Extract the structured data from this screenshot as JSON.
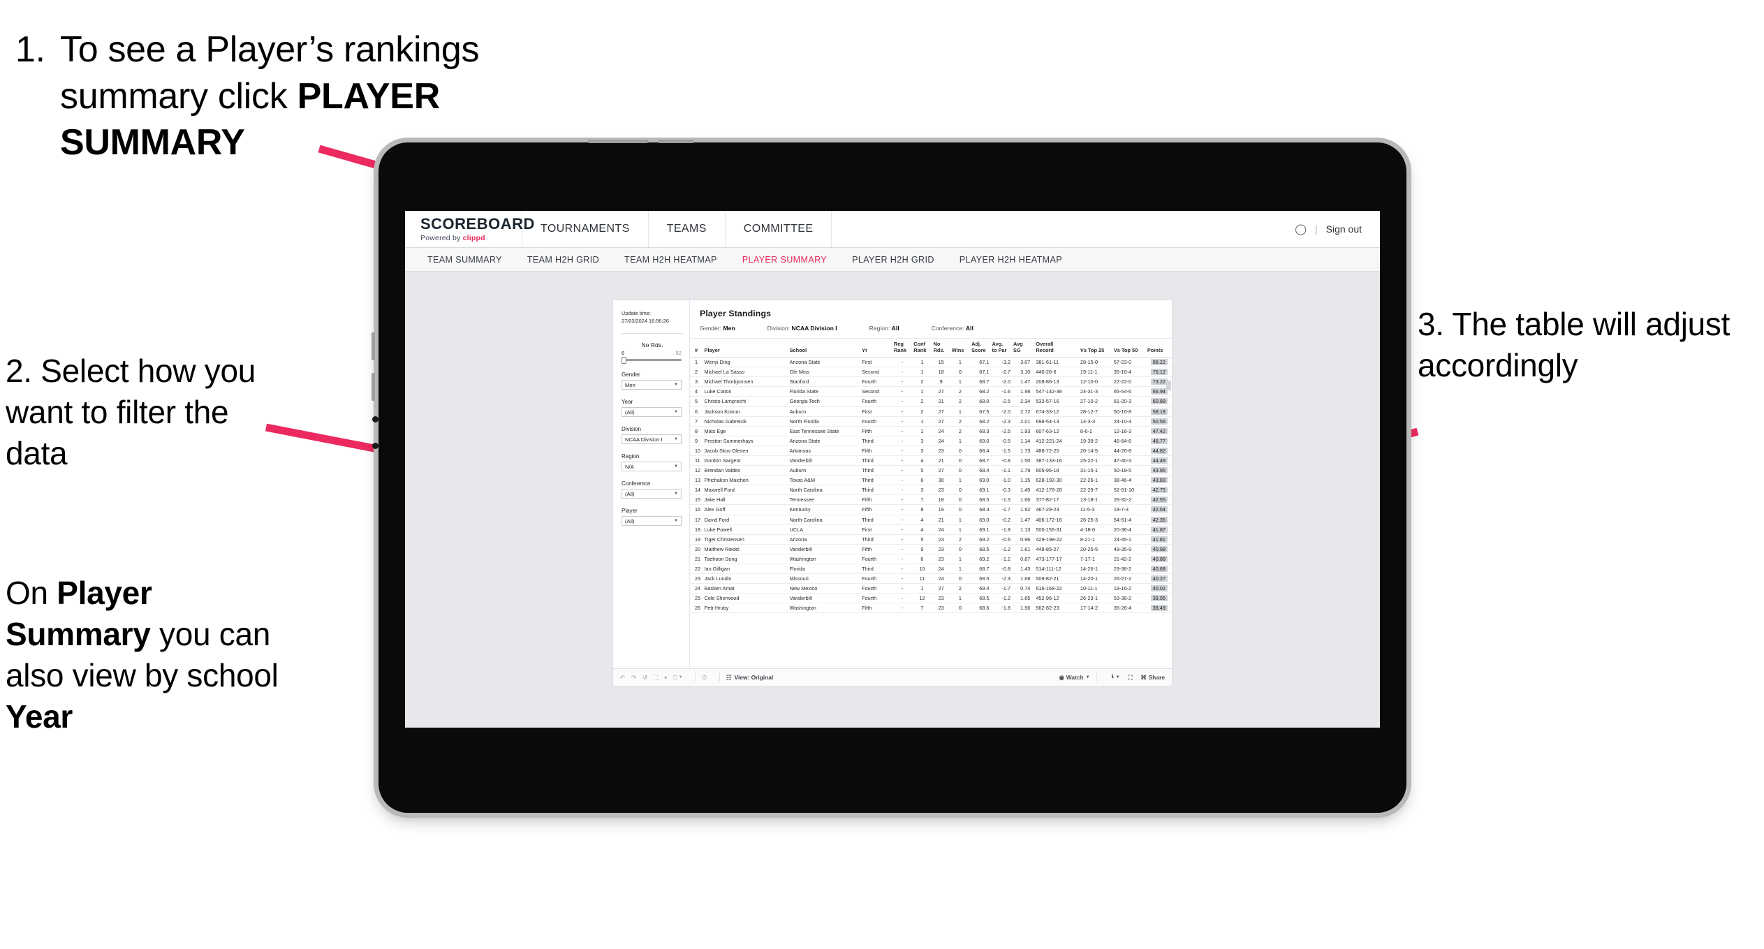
{
  "callouts": {
    "one": {
      "number": "1.",
      "line1_pre": "To see a Player’s rankings",
      "line2_pre": "summary click ",
      "line2_bold": "PLAYER",
      "line3_bold": "SUMMARY"
    },
    "two": {
      "text": "2. Select how you want to filter the data"
    },
    "two_b": {
      "pre": "On ",
      "bold1": "Player Summary",
      "mid": " you can also view by school ",
      "bold2": "Year"
    },
    "three": {
      "text": "3. The table will adjust accordingly"
    }
  },
  "accent_color": "#e8285a",
  "app": {
    "brand": {
      "name": "SCOREBOARD",
      "powered_by_prefix": "Powered by ",
      "powered_by_brand": "clippd"
    },
    "top_nav": [
      {
        "label": "TOURNAMENTS"
      },
      {
        "label": "TEAMS"
      },
      {
        "label": "COMMITTEE"
      }
    ],
    "top_right": {
      "user_icon": "user-icon",
      "separator": "|",
      "sign_out": "Sign out"
    },
    "sub_nav": [
      {
        "label": "TEAM SUMMARY",
        "active": false
      },
      {
        "label": "TEAM H2H GRID",
        "active": false
      },
      {
        "label": "TEAM H2H HEATMAP",
        "active": false
      },
      {
        "label": "PLAYER SUMMARY",
        "active": true
      },
      {
        "label": "PLAYER H2H GRID",
        "active": false
      },
      {
        "label": "PLAYER H2H HEATMAP",
        "active": false
      }
    ]
  },
  "filters": {
    "update_time_label": "Update time:",
    "update_time_value": "27/03/2024 16:56:26",
    "slider": {
      "label": "No Rds.",
      "min_value": "6",
      "max_value": "52"
    },
    "groups": [
      {
        "label": "Gender",
        "value": "Men"
      },
      {
        "label": "Year",
        "value": "(All)"
      },
      {
        "label": "Division",
        "value": "NCAA Division I"
      },
      {
        "label": "Region",
        "value": "N/A"
      },
      {
        "label": "Conference",
        "value": "(All)"
      },
      {
        "label": "Player",
        "value": "(All)"
      }
    ]
  },
  "viz": {
    "title": "Player Standings",
    "filter_line": [
      {
        "label": "Gender:",
        "value": "Men"
      },
      {
        "label": "Division:",
        "value": "NCAA Division I"
      },
      {
        "label": "Region:",
        "value": "All"
      },
      {
        "label": "Conference:",
        "value": "All"
      }
    ],
    "toolbar": {
      "view_label": "View: Original",
      "watch_label": "Watch",
      "share_label": "Share"
    }
  },
  "chart_data": {
    "type": "table",
    "title": "Player Standings",
    "columns": [
      "#",
      "Player",
      "School",
      "Yr",
      "Reg Rank",
      "Conf Rank",
      "No Rds.",
      "Wins",
      "Adj. Score",
      "Avg. to Par",
      "Avg SG",
      "Overall Record",
      "Vs Top 25",
      "Vs Top 50",
      "Points"
    ],
    "column_headers_two_line": [
      [
        "#",
        ""
      ],
      [
        "Player",
        ""
      ],
      [
        "School",
        ""
      ],
      [
        "Yr",
        ""
      ],
      [
        "Reg",
        "Rank"
      ],
      [
        "Conf",
        "Rank"
      ],
      [
        "No",
        "Rds."
      ],
      [
        "",
        "Wins"
      ],
      [
        "Adj.",
        "Score"
      ],
      [
        "Avg.",
        "to Par"
      ],
      [
        "Avg",
        "SG"
      ],
      [
        "Overall",
        "Record"
      ],
      [
        "Vs Top 25",
        ""
      ],
      [
        "Vs Top 50",
        ""
      ],
      [
        "Points",
        ""
      ]
    ],
    "rows": [
      [
        "1",
        "Wenyi Ding",
        "Arizona State",
        "First",
        "-",
        "1",
        "15",
        "1",
        "67.1",
        "-3.2",
        "3.07",
        "381-61-11",
        "28-15-0",
        "57-23-0",
        "88.22"
      ],
      [
        "2",
        "Michael La Sasso",
        "Ole Miss",
        "Second",
        "-",
        "1",
        "18",
        "0",
        "67.1",
        "-2.7",
        "3.10",
        "440-26-6",
        "19-11-1",
        "35-16-4",
        "76.12"
      ],
      [
        "3",
        "Michael Thorbjornsen",
        "Stanford",
        "Fourth",
        "-",
        "2",
        "9",
        "1",
        "68.7",
        "-2.0",
        "1.47",
        "208-86-13",
        "12-10-0",
        "22-22-0",
        "73.22"
      ],
      [
        "4",
        "Luke Claton",
        "Florida State",
        "Second",
        "-",
        "1",
        "27",
        "2",
        "68.2",
        "-1.6",
        "1.98",
        "547-142-38",
        "24-31-3",
        "65-54-6",
        "66.94"
      ],
      [
        "5",
        "Christo Lamprecht",
        "Georgia Tech",
        "Fourth",
        "-",
        "2",
        "21",
        "2",
        "68.0",
        "-2.5",
        "2.34",
        "533-57-16",
        "27-10-2",
        "61-20-3",
        "60.89"
      ],
      [
        "6",
        "Jackson Koivun",
        "Auburn",
        "First",
        "-",
        "2",
        "27",
        "1",
        "67.5",
        "-2.0",
        "2.72",
        "674-33-12",
        "28-12-7",
        "50-16-8",
        "58.18"
      ],
      [
        "7",
        "Nicholas Gabrelcik",
        "North Florida",
        "Fourth",
        "-",
        "1",
        "27",
        "2",
        "68.2",
        "-2.3",
        "2.01",
        "698-54-13",
        "14-3-3",
        "24-10-4",
        "50.56"
      ],
      [
        "8",
        "Mats Ege",
        "East Tennessee State",
        "Fifth",
        "-",
        "1",
        "24",
        "2",
        "68.3",
        "-2.5",
        "1.93",
        "607-63-12",
        "8-6-1",
        "12-16-3",
        "47.42"
      ],
      [
        "9",
        "Preston Summerhays",
        "Arizona State",
        "Third",
        "-",
        "3",
        "24",
        "1",
        "69.0",
        "-0.5",
        "1.14",
        "412-221-24",
        "19-39-2",
        "46-64-6",
        "46.77"
      ],
      [
        "10",
        "Jacob Skov Olesen",
        "Arkansas",
        "Fifth",
        "-",
        "3",
        "23",
        "0",
        "68.4",
        "-1.5",
        "1.73",
        "488-72-25",
        "20-14-5",
        "44-26-8",
        "44.82"
      ],
      [
        "11",
        "Gordon Sargent",
        "Vanderbilt",
        "Third",
        "-",
        "4",
        "21",
        "0",
        "68.7",
        "-0.8",
        "1.50",
        "387-133-16",
        "25-22-1",
        "47-40-3",
        "44.49"
      ],
      [
        "12",
        "Brendan Valdes",
        "Auburn",
        "Third",
        "-",
        "5",
        "27",
        "0",
        "68.4",
        "-1.1",
        "1.79",
        "605-96-18",
        "31-15-1",
        "50-18-5",
        "43.95"
      ],
      [
        "13",
        "Phichaksn Maichon",
        "Texas A&M",
        "Third",
        "-",
        "6",
        "30",
        "1",
        "69.0",
        "-1.0",
        "1.15",
        "628-192-30",
        "22-26-1",
        "38-46-4",
        "43.83"
      ],
      [
        "14",
        "Maxwell Ford",
        "North Carolina",
        "Third",
        "-",
        "3",
        "23",
        "0",
        "69.1",
        "-0.3",
        "1.45",
        "412-178-28",
        "22-29-7",
        "52-51-10",
        "42.75"
      ],
      [
        "15",
        "Jake Hall",
        "Tennessee",
        "Fifth",
        "-",
        "7",
        "18",
        "0",
        "68.5",
        "-1.5",
        "1.66",
        "377-82-17",
        "13-18-1",
        "26-32-2",
        "42.55"
      ],
      [
        "16",
        "Alex Goff",
        "Kentucky",
        "Fifth",
        "-",
        "8",
        "19",
        "0",
        "68.3",
        "-1.7",
        "1.92",
        "467-29-23",
        "11-5-3",
        "18-7-3",
        "42.54"
      ],
      [
        "17",
        "David Ford",
        "North Carolina",
        "Third",
        "-",
        "4",
        "21",
        "1",
        "69.0",
        "-0.2",
        "1.47",
        "406-172-16",
        "26-25-3",
        "54-51-4",
        "42.35"
      ],
      [
        "18",
        "Luke Powell",
        "UCLA",
        "First",
        "-",
        "4",
        "24",
        "1",
        "69.1",
        "-1.8",
        "1.13",
        "500-155-31",
        "4-18-0",
        "20-36-4",
        "41.87"
      ],
      [
        "19",
        "Tiger Christensen",
        "Arizona",
        "Third",
        "-",
        "5",
        "23",
        "2",
        "69.2",
        "-0.6",
        "0.96",
        "429-198-22",
        "8-21-1",
        "24-45-1",
        "41.81"
      ],
      [
        "20",
        "Matthew Riedel",
        "Vanderbilt",
        "Fifth",
        "-",
        "9",
        "23",
        "0",
        "68.5",
        "-1.2",
        "1.61",
        "448-85-27",
        "20-25-5",
        "49-35-9",
        "40.98"
      ],
      [
        "21",
        "Taehoon Song",
        "Washington",
        "Fourth",
        "-",
        "6",
        "23",
        "1",
        "69.2",
        "-1.2",
        "0.87",
        "473-177-17",
        "7-17-1",
        "21-42-2",
        "40.88"
      ],
      [
        "22",
        "Ian Gilligan",
        "Florida",
        "Third",
        "-",
        "10",
        "24",
        "1",
        "68.7",
        "-0.8",
        "1.43",
        "514-111-12",
        "14-26-1",
        "29-38-2",
        "40.68"
      ],
      [
        "23",
        "Jack Lundin",
        "Missouri",
        "Fourth",
        "-",
        "11",
        "24",
        "0",
        "68.5",
        "-2.3",
        "1.68",
        "509-82-21",
        "14-20-1",
        "26-27-2",
        "40.27"
      ],
      [
        "24",
        "Bastien Amat",
        "New Mexico",
        "Fourth",
        "-",
        "1",
        "27",
        "2",
        "69.4",
        "-1.7",
        "0.74",
        "616-168-22",
        "10-11-1",
        "19-16-2",
        "40.02"
      ],
      [
        "25",
        "Cole Sherwood",
        "Vanderbilt",
        "Fourth",
        "-",
        "12",
        "23",
        "1",
        "68.5",
        "-1.2",
        "1.65",
        "452-96-12",
        "26-23-1",
        "53-38-2",
        "39.95"
      ],
      [
        "26",
        "Petr Hruby",
        "Washington",
        "Fifth",
        "-",
        "7",
        "23",
        "0",
        "68.6",
        "-1.8",
        "1.56",
        "562-82-23",
        "17-14-2",
        "35-26-4",
        "39.49"
      ]
    ]
  }
}
